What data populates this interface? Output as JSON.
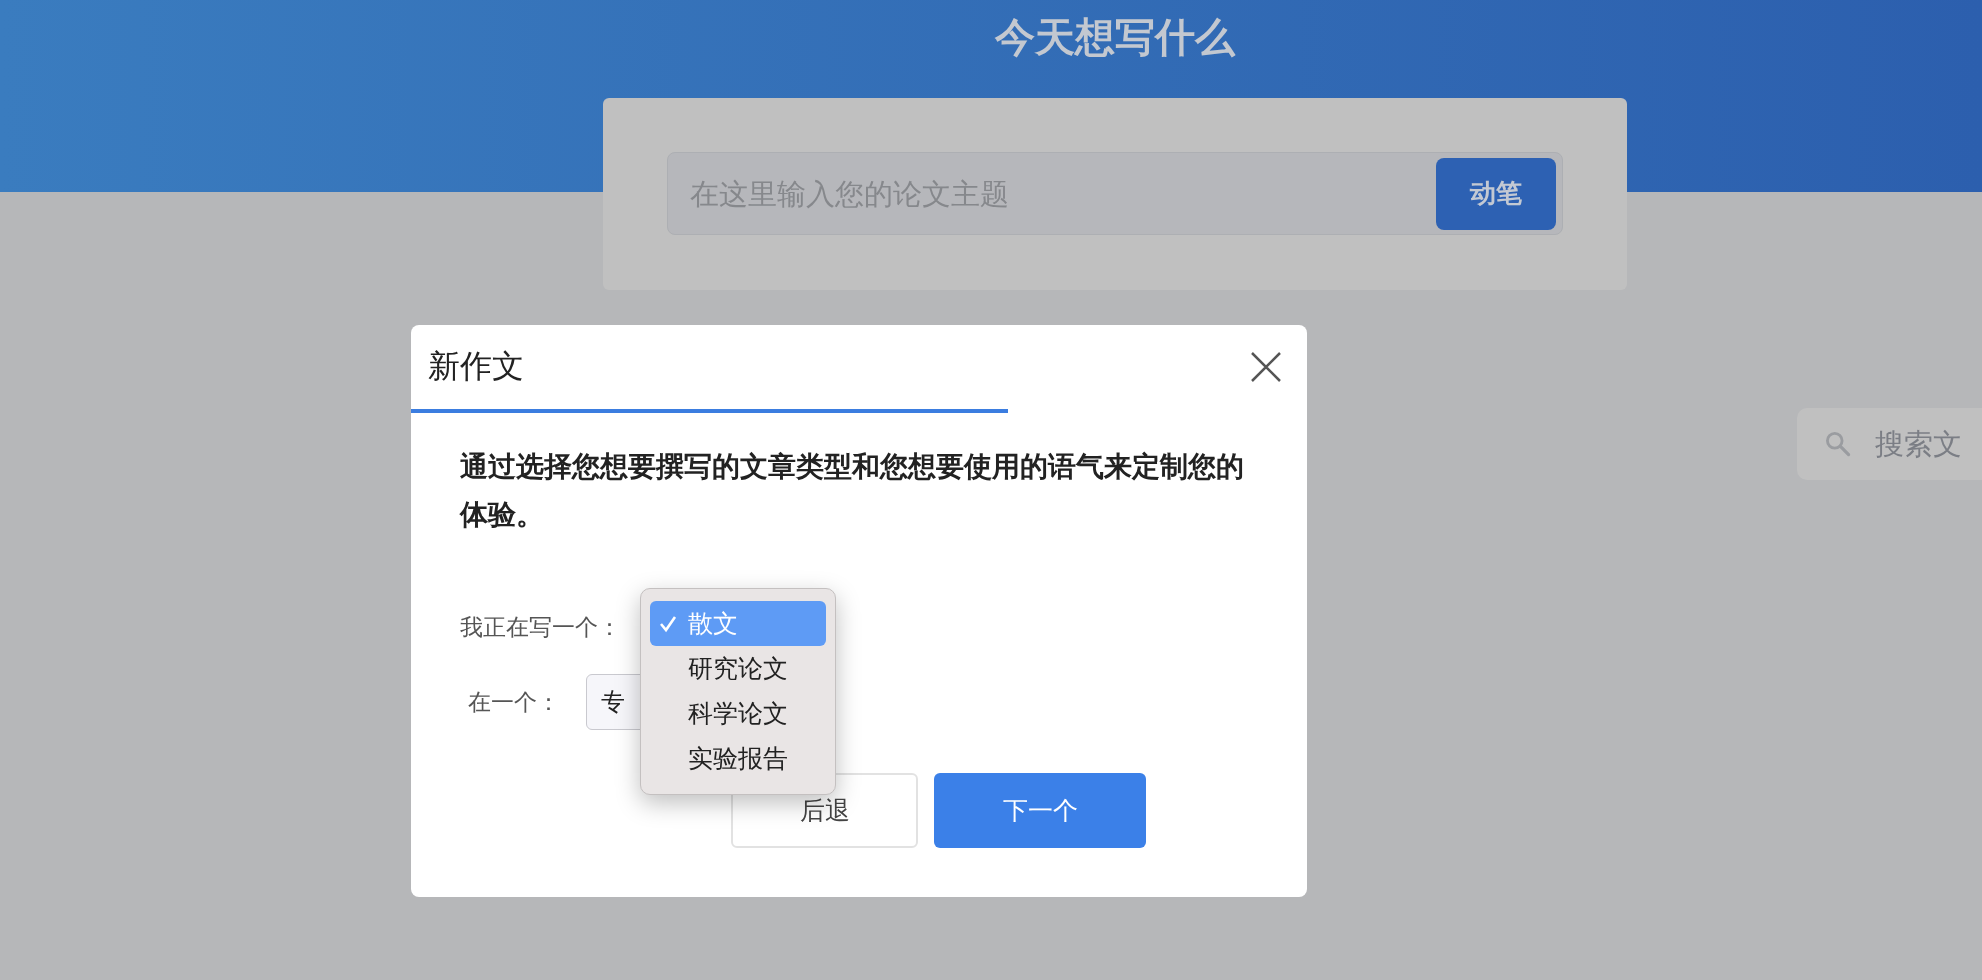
{
  "header": {
    "title": "今天想写什么"
  },
  "topic_search": {
    "placeholder": "在这里输入您的论文主题",
    "button": "动笔"
  },
  "file_search": {
    "placeholder": "搜索文"
  },
  "dialog": {
    "title": "新作文",
    "description": "通过选择您想要撰写的文章类型和您想要使用的语气来定制您的体验。",
    "fields": [
      {
        "label": "我正在写一个："
      },
      {
        "label": "在一个：",
        "value": "专"
      }
    ],
    "menu": [
      {
        "label": "散文",
        "selected": true
      },
      {
        "label": "研究论文",
        "selected": false
      },
      {
        "label": "科学论文",
        "selected": false
      },
      {
        "label": "实验报告",
        "selected": false
      }
    ],
    "buttons": [
      {
        "label": "后退",
        "kind": "secondary"
      },
      {
        "label": "下一个",
        "kind": "primary"
      }
    ]
  }
}
